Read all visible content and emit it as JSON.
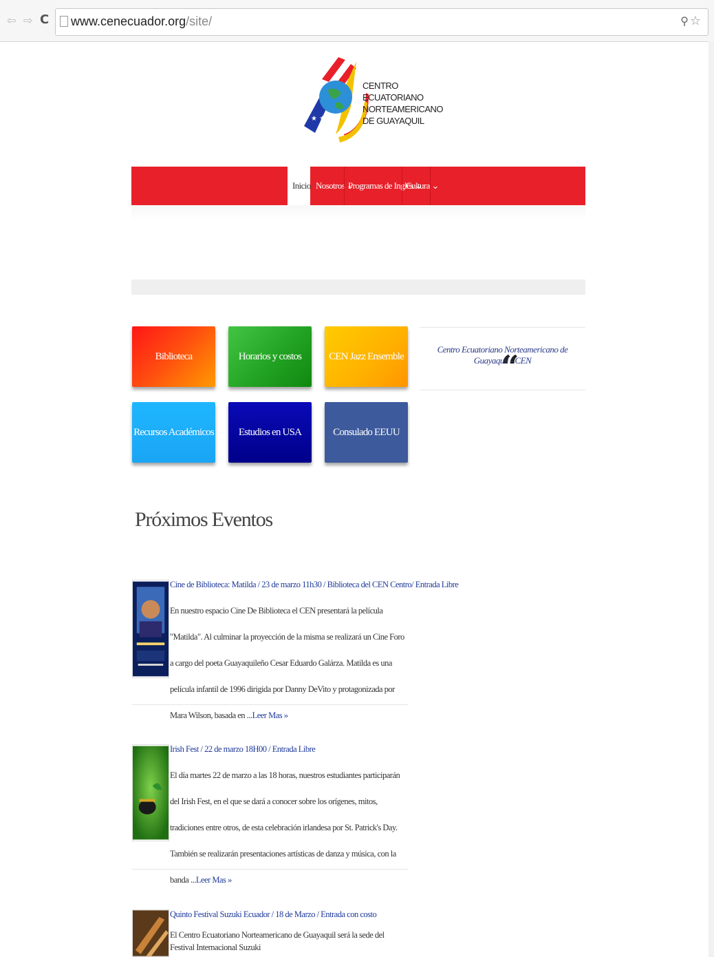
{
  "browser": {
    "url_domain": "www.cenecuador.org",
    "url_path": "/site/",
    "back_icon": "back-arrow-icon",
    "forward_icon": "forward-arrow-icon",
    "reload_icon": "reload-icon"
  },
  "logo": {
    "line1": "CENTRO",
    "line2": "ECUATORIANO",
    "line3": "NORTEAMERICANO",
    "line4": "DE GUAYAQUIL"
  },
  "nav": {
    "items": [
      {
        "label": "Inicio"
      },
      {
        "label": "Nosotros ⌄"
      },
      {
        "label": "Programas de Inglés ⌄"
      },
      {
        "label": "Cultura ⌄"
      }
    ],
    "color": "#e8202a"
  },
  "tiles": [
    {
      "label": "Biblioteca"
    },
    {
      "label": "Horarios y costos"
    },
    {
      "label": "CEN Jazz Ensemble"
    },
    {
      "label": "Recursos Académicos"
    },
    {
      "label": "Estudios en USA"
    },
    {
      "label": "Consulado EEUU"
    }
  ],
  "quote": {
    "text": "Centro Ecuatoriano Norteamericano de Guayaquil - CEN",
    "mark": "“"
  },
  "section": {
    "title": "Próximos Eventos"
  },
  "events": [
    {
      "title": "Cine de Biblioteca: Matilda / 23 de marzo 11h30 / Biblioteca del CEN Centro/ Entrada Libre",
      "body": "En nuestro espacio Cine De Biblioteca el CEN presentará la película \"Matilda\". Al culminar la proyección de la misma se realizará un Cine Foro a cargo del poeta Guayaquileño Cesar Eduardo Galárza. Matilda es una película infantil de 1996 dirigida por Danny DeVito y protagonizada por Mara Wilson, basada en ...",
      "more": "Leer Mas »"
    },
    {
      "title": "Irish Fest / 22 de marzo 18H00 / Entrada Libre",
      "body": "El día martes 22 de marzo a las 18 horas, nuestros estudiantes participarán del Irish Fest, en el que se dará a conocer sobre los orígenes, mitos, tradiciones entre otros, de esta celebración irlandesa por St. Patrick's Day. También se realizarán presentaciones artísticas de danza y música, con la banda ...",
      "more": "Leer Mas »"
    },
    {
      "title": "Quinto Festival Suzuki Ecuador / 18 de Marzo / Entrada con costo",
      "body": "El Centro Ecuatoriano Norteamericano de Guayaquil será la sede del Festival Internacional Suzuki"
    }
  ]
}
